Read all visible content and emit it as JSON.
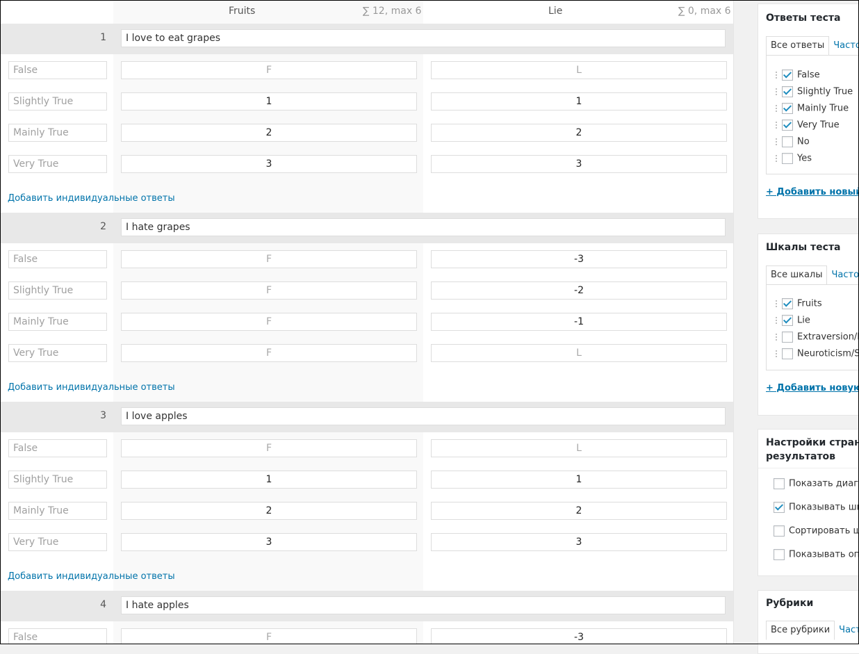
{
  "table": {
    "scales": [
      {
        "name": "Fruits",
        "sum": "∑ 12, max 6"
      },
      {
        "name": "Lie",
        "sum": "∑ 0, max 6"
      }
    ],
    "add_link": "Добавить индивидуальные ответы",
    "questions": [
      {
        "num": "1",
        "text": "I love to eat grapes",
        "rows": [
          {
            "answer": "False",
            "v1": "F",
            "v1_placeholder": true,
            "v2": "L",
            "v2_placeholder": true
          },
          {
            "answer": "Slightly True",
            "v1": "1",
            "v1_placeholder": false,
            "v2": "1",
            "v2_placeholder": false
          },
          {
            "answer": "Mainly True",
            "v1": "2",
            "v1_placeholder": false,
            "v2": "2",
            "v2_placeholder": false
          },
          {
            "answer": "Very True",
            "v1": "3",
            "v1_placeholder": false,
            "v2": "3",
            "v2_placeholder": false
          }
        ]
      },
      {
        "num": "2",
        "text": "I hate grapes",
        "rows": [
          {
            "answer": "False",
            "v1": "F",
            "v1_placeholder": true,
            "v2": "-3",
            "v2_placeholder": false
          },
          {
            "answer": "Slightly True",
            "v1": "F",
            "v1_placeholder": true,
            "v2": "-2",
            "v2_placeholder": false
          },
          {
            "answer": "Mainly True",
            "v1": "F",
            "v1_placeholder": true,
            "v2": "-1",
            "v2_placeholder": false
          },
          {
            "answer": "Very True",
            "v1": "F",
            "v1_placeholder": true,
            "v2": "L",
            "v2_placeholder": true
          }
        ]
      },
      {
        "num": "3",
        "text": "I love apples",
        "rows": [
          {
            "answer": "False",
            "v1": "F",
            "v1_placeholder": true,
            "v2": "L",
            "v2_placeholder": true
          },
          {
            "answer": "Slightly True",
            "v1": "1",
            "v1_placeholder": false,
            "v2": "1",
            "v2_placeholder": false
          },
          {
            "answer": "Mainly True",
            "v1": "2",
            "v1_placeholder": false,
            "v2": "2",
            "v2_placeholder": false
          },
          {
            "answer": "Very True",
            "v1": "3",
            "v1_placeholder": false,
            "v2": "3",
            "v2_placeholder": false
          }
        ]
      },
      {
        "num": "4",
        "text": "I hate apples",
        "rows": [
          {
            "answer": "False",
            "v1": "F",
            "v1_placeholder": true,
            "v2": "-3",
            "v2_placeholder": false
          }
        ]
      }
    ]
  },
  "sidebar": {
    "answers_panel": {
      "title": "Ответы теста",
      "tab_all": "Все ответы",
      "tab_common": "Часто",
      "items": [
        {
          "label": "False",
          "checked": true
        },
        {
          "label": "Slightly True",
          "checked": true
        },
        {
          "label": "Mainly True",
          "checked": true
        },
        {
          "label": "Very True",
          "checked": true
        },
        {
          "label": "No",
          "checked": false
        },
        {
          "label": "Yes",
          "checked": false
        }
      ],
      "add_new": "+ Добавить новый о"
    },
    "scales_panel": {
      "title": "Шкалы теста",
      "tab_all": "Все шкалы",
      "tab_common": "Часто",
      "items": [
        {
          "label": "Fruits",
          "checked": true
        },
        {
          "label": "Lie",
          "checked": true
        },
        {
          "label": "Extraversion/In",
          "checked": false
        },
        {
          "label": "Neuroticism/S",
          "checked": false
        }
      ],
      "add_new": "+ Добавить новую ш"
    },
    "results_panel": {
      "title_line1": "Настройки страни",
      "title_line2": "результатов",
      "options": [
        {
          "label": "Показать диагр",
          "checked": false
        },
        {
          "label": "Показывать шка",
          "checked": true
        },
        {
          "label": "Сортировать ш",
          "checked": false
        },
        {
          "label": "Показывать опи",
          "checked": false
        }
      ]
    },
    "categories_panel": {
      "title": "Рубрики",
      "tab_all": "Все рубрики",
      "tab_common": "Част"
    }
  }
}
